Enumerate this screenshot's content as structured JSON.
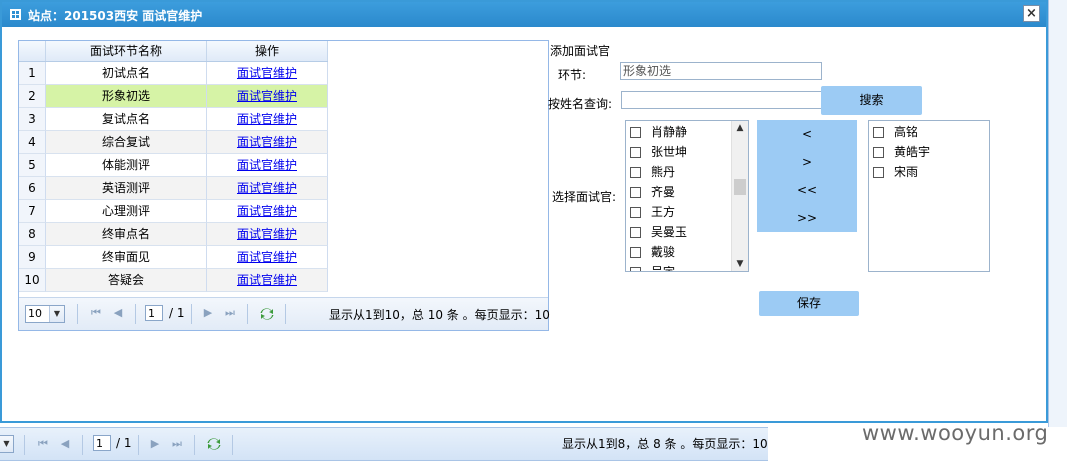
{
  "dialog": {
    "title": "站点：201503西安 面试官维护",
    "close_label": "×"
  },
  "grid": {
    "columns": [
      "",
      "面试环节名称",
      "操作"
    ],
    "rows": [
      {
        "num": "1",
        "name": "初试点名",
        "op": "面试官维护"
      },
      {
        "num": "2",
        "name": "形象初选",
        "op": "面试官维护"
      },
      {
        "num": "3",
        "name": "复试点名",
        "op": "面试官维护"
      },
      {
        "num": "4",
        "name": "综合复试",
        "op": "面试官维护"
      },
      {
        "num": "5",
        "name": "体能测评",
        "op": "面试官维护"
      },
      {
        "num": "6",
        "name": "英语测评",
        "op": "面试官维护"
      },
      {
        "num": "7",
        "name": "心理测评",
        "op": "面试官维护"
      },
      {
        "num": "8",
        "name": "终审点名",
        "op": "面试官维护"
      },
      {
        "num": "9",
        "name": "终审面见",
        "op": "面试官维护"
      },
      {
        "num": "10",
        "name": "答疑会",
        "op": "面试官维护"
      }
    ],
    "selected_row": 2,
    "pager": {
      "page_size": "10",
      "page": "1",
      "total_pages": "/ 1",
      "info": "显示从1到10，总 10 条 。每页显示：10"
    }
  },
  "form": {
    "heading": "添加面试官",
    "stage_label": "环节:",
    "stage_value": "形象初选",
    "search_label": "按姓名查询:",
    "search_value": "",
    "search_button": "搜索",
    "select_label": "选择面试官:",
    "available": [
      "肖静静",
      "张世坤",
      "熊丹",
      "齐曼",
      "王方",
      "吴曼玉",
      "戴骏",
      "吴宇"
    ],
    "selected": [
      "高铭",
      "黄皓宇",
      "宋雨"
    ],
    "move_buttons": [
      "<",
      ">",
      "<<",
      ">>"
    ],
    "save_button": "保存"
  },
  "background_pager": {
    "page": "1",
    "total_pages": "/ 1",
    "info": "显示从1到8，总 8 条 。每页显示：10"
  },
  "watermark": "www.wooyun.org",
  "colors": {
    "titlebar": "#2f90d2",
    "selected_row": "#d6f3a6",
    "button": "#9ccbf4",
    "link": "#0000ee"
  }
}
